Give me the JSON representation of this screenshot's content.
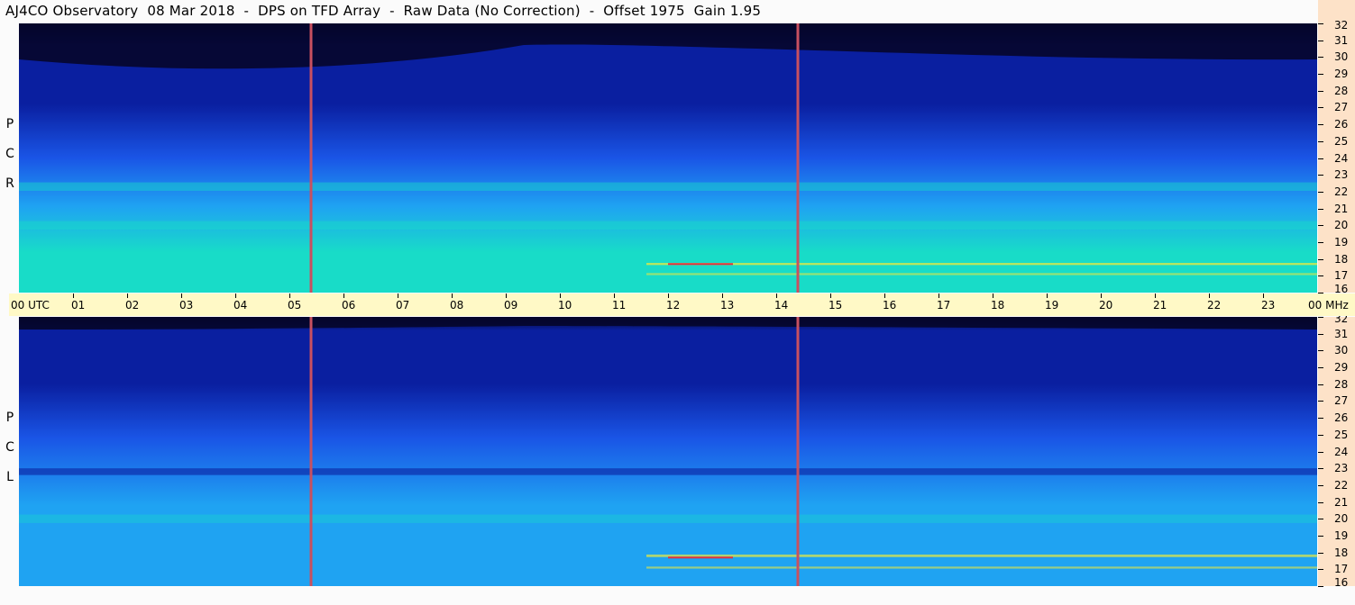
{
  "title": "AJ4CO Observatory  08 Mar 2018  -  DPS on TFD Array  -  Raw Data (No Correction)  -  Offset 1975  Gain 1.95",
  "panels": {
    "top": {
      "label": [
        "R",
        "C",
        "P"
      ]
    },
    "bottom": {
      "label": [
        "L",
        "C",
        "P"
      ]
    }
  },
  "freq_axis": {
    "unit": "MHz",
    "ticks": [
      "32",
      "31",
      "30",
      "29",
      "28",
      "27",
      "26",
      "25",
      "24",
      "23",
      "22",
      "21",
      "20",
      "19",
      "18",
      "17",
      "16"
    ]
  },
  "time_axis": {
    "start_label": "00",
    "start_unit": "UTC",
    "end_label": "00",
    "end_unit": "MHz",
    "ticks": [
      "01",
      "02",
      "03",
      "04",
      "05",
      "06",
      "07",
      "08",
      "09",
      "10",
      "11",
      "12",
      "13",
      "14",
      "15",
      "16",
      "17",
      "18",
      "19",
      "20",
      "21",
      "22",
      "23"
    ]
  },
  "chart_data": {
    "type": "heatmap",
    "title": "AJ4CO Observatory  08 Mar 2018  -  DPS on TFD Array  -  Raw Data (No Correction)  -  Offset 1975  Gain 1.95",
    "x_unit": "UTC",
    "y_unit": "MHz",
    "xlim": [
      0,
      24
    ],
    "ylim": [
      16,
      32
    ],
    "marker_lines_utc": [
      5.4,
      14.4
    ],
    "colors": {
      "dark": "#06062a",
      "deep": "#0a1fa0",
      "mid": "#1a55e6",
      "bright": "#1fa3f2",
      "cyan": "#18dcc8",
      "yellow": "#e8e840",
      "red": "#e03040",
      "marker": "#c85060"
    },
    "polarizations": [
      "RCP",
      "LCP"
    ]
  }
}
